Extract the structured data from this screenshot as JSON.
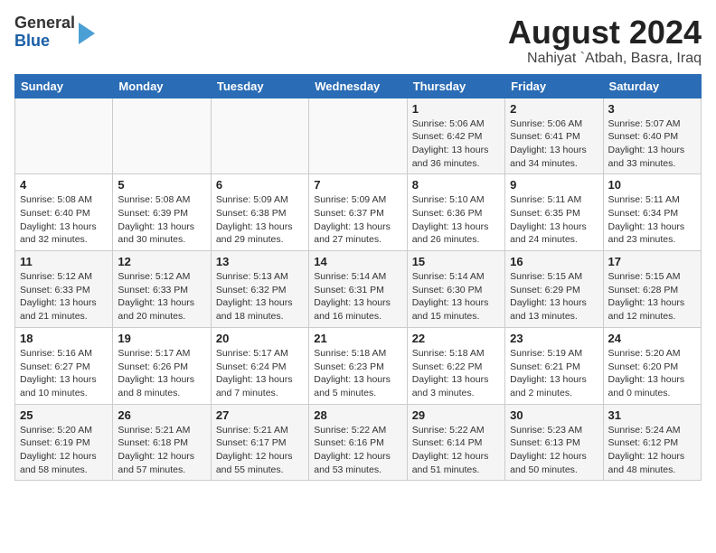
{
  "header": {
    "logo_line1": "General",
    "logo_line2": "Blue",
    "month_year": "August 2024",
    "location": "Nahiyat `Atbah, Basra, Iraq"
  },
  "calendar": {
    "days_of_week": [
      "Sunday",
      "Monday",
      "Tuesday",
      "Wednesday",
      "Thursday",
      "Friday",
      "Saturday"
    ],
    "weeks": [
      {
        "days": [
          {
            "num": "",
            "info": ""
          },
          {
            "num": "",
            "info": ""
          },
          {
            "num": "",
            "info": ""
          },
          {
            "num": "",
            "info": ""
          },
          {
            "num": "1",
            "info": "Sunrise: 5:06 AM\nSunset: 6:42 PM\nDaylight: 13 hours\nand 36 minutes."
          },
          {
            "num": "2",
            "info": "Sunrise: 5:06 AM\nSunset: 6:41 PM\nDaylight: 13 hours\nand 34 minutes."
          },
          {
            "num": "3",
            "info": "Sunrise: 5:07 AM\nSunset: 6:40 PM\nDaylight: 13 hours\nand 33 minutes."
          }
        ]
      },
      {
        "days": [
          {
            "num": "4",
            "info": "Sunrise: 5:08 AM\nSunset: 6:40 PM\nDaylight: 13 hours\nand 32 minutes."
          },
          {
            "num": "5",
            "info": "Sunrise: 5:08 AM\nSunset: 6:39 PM\nDaylight: 13 hours\nand 30 minutes."
          },
          {
            "num": "6",
            "info": "Sunrise: 5:09 AM\nSunset: 6:38 PM\nDaylight: 13 hours\nand 29 minutes."
          },
          {
            "num": "7",
            "info": "Sunrise: 5:09 AM\nSunset: 6:37 PM\nDaylight: 13 hours\nand 27 minutes."
          },
          {
            "num": "8",
            "info": "Sunrise: 5:10 AM\nSunset: 6:36 PM\nDaylight: 13 hours\nand 26 minutes."
          },
          {
            "num": "9",
            "info": "Sunrise: 5:11 AM\nSunset: 6:35 PM\nDaylight: 13 hours\nand 24 minutes."
          },
          {
            "num": "10",
            "info": "Sunrise: 5:11 AM\nSunset: 6:34 PM\nDaylight: 13 hours\nand 23 minutes."
          }
        ]
      },
      {
        "days": [
          {
            "num": "11",
            "info": "Sunrise: 5:12 AM\nSunset: 6:33 PM\nDaylight: 13 hours\nand 21 minutes."
          },
          {
            "num": "12",
            "info": "Sunrise: 5:12 AM\nSunset: 6:33 PM\nDaylight: 13 hours\nand 20 minutes."
          },
          {
            "num": "13",
            "info": "Sunrise: 5:13 AM\nSunset: 6:32 PM\nDaylight: 13 hours\nand 18 minutes."
          },
          {
            "num": "14",
            "info": "Sunrise: 5:14 AM\nSunset: 6:31 PM\nDaylight: 13 hours\nand 16 minutes."
          },
          {
            "num": "15",
            "info": "Sunrise: 5:14 AM\nSunset: 6:30 PM\nDaylight: 13 hours\nand 15 minutes."
          },
          {
            "num": "16",
            "info": "Sunrise: 5:15 AM\nSunset: 6:29 PM\nDaylight: 13 hours\nand 13 minutes."
          },
          {
            "num": "17",
            "info": "Sunrise: 5:15 AM\nSunset: 6:28 PM\nDaylight: 13 hours\nand 12 minutes."
          }
        ]
      },
      {
        "days": [
          {
            "num": "18",
            "info": "Sunrise: 5:16 AM\nSunset: 6:27 PM\nDaylight: 13 hours\nand 10 minutes."
          },
          {
            "num": "19",
            "info": "Sunrise: 5:17 AM\nSunset: 6:26 PM\nDaylight: 13 hours\nand 8 minutes."
          },
          {
            "num": "20",
            "info": "Sunrise: 5:17 AM\nSunset: 6:24 PM\nDaylight: 13 hours\nand 7 minutes."
          },
          {
            "num": "21",
            "info": "Sunrise: 5:18 AM\nSunset: 6:23 PM\nDaylight: 13 hours\nand 5 minutes."
          },
          {
            "num": "22",
            "info": "Sunrise: 5:18 AM\nSunset: 6:22 PM\nDaylight: 13 hours\nand 3 minutes."
          },
          {
            "num": "23",
            "info": "Sunrise: 5:19 AM\nSunset: 6:21 PM\nDaylight: 13 hours\nand 2 minutes."
          },
          {
            "num": "24",
            "info": "Sunrise: 5:20 AM\nSunset: 6:20 PM\nDaylight: 13 hours\nand 0 minutes."
          }
        ]
      },
      {
        "days": [
          {
            "num": "25",
            "info": "Sunrise: 5:20 AM\nSunset: 6:19 PM\nDaylight: 12 hours\nand 58 minutes."
          },
          {
            "num": "26",
            "info": "Sunrise: 5:21 AM\nSunset: 6:18 PM\nDaylight: 12 hours\nand 57 minutes."
          },
          {
            "num": "27",
            "info": "Sunrise: 5:21 AM\nSunset: 6:17 PM\nDaylight: 12 hours\nand 55 minutes."
          },
          {
            "num": "28",
            "info": "Sunrise: 5:22 AM\nSunset: 6:16 PM\nDaylight: 12 hours\nand 53 minutes."
          },
          {
            "num": "29",
            "info": "Sunrise: 5:22 AM\nSunset: 6:14 PM\nDaylight: 12 hours\nand 51 minutes."
          },
          {
            "num": "30",
            "info": "Sunrise: 5:23 AM\nSunset: 6:13 PM\nDaylight: 12 hours\nand 50 minutes."
          },
          {
            "num": "31",
            "info": "Sunrise: 5:24 AM\nSunset: 6:12 PM\nDaylight: 12 hours\nand 48 minutes."
          }
        ]
      }
    ]
  }
}
